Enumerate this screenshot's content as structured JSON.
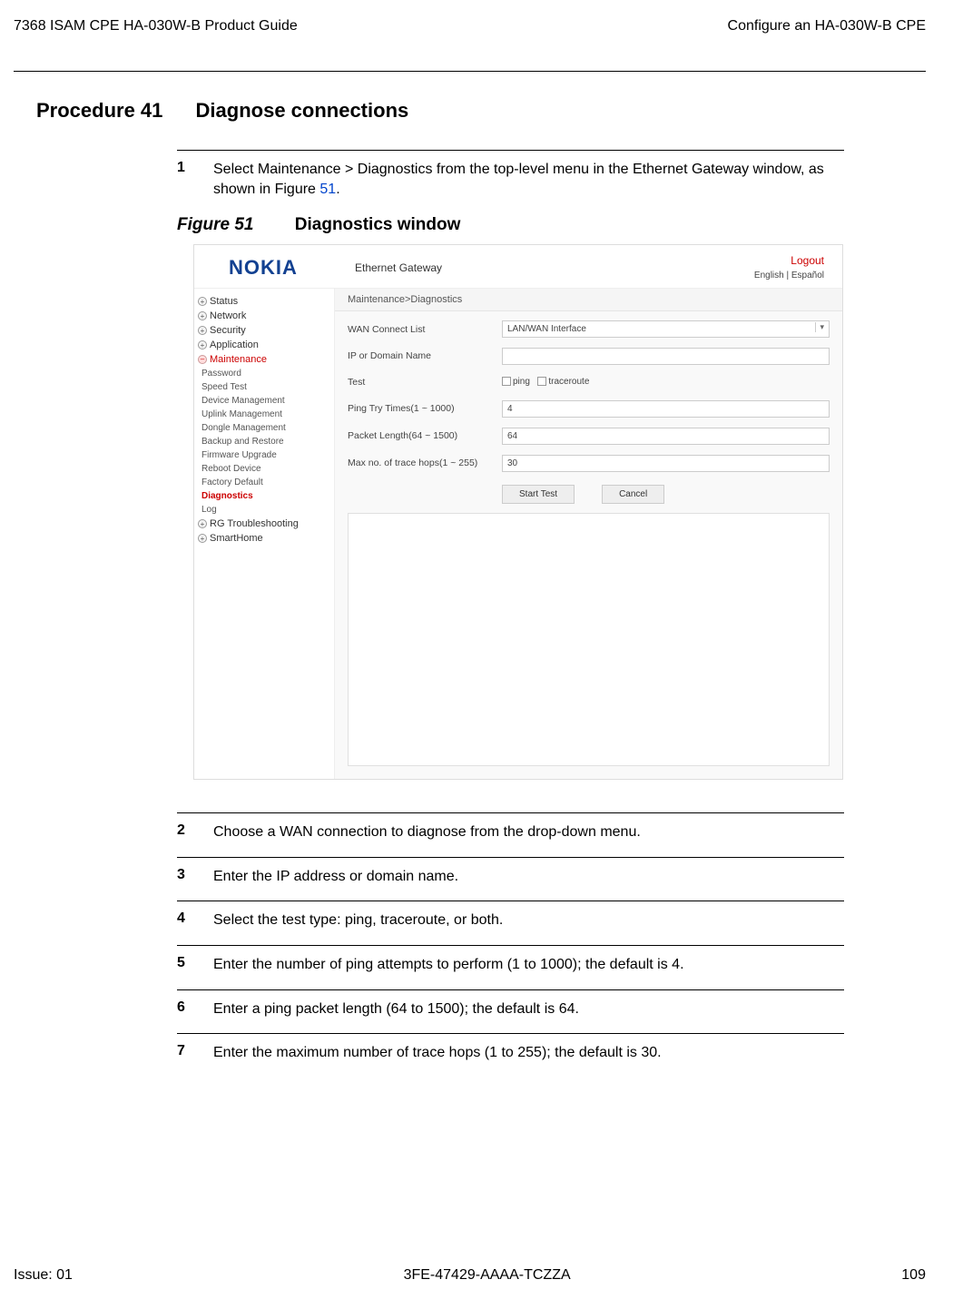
{
  "header": {
    "left": "7368 ISAM CPE HA-030W-B Product Guide",
    "right": "Configure an HA-030W-B CPE"
  },
  "procedure": {
    "number": "Procedure 41",
    "title": "Diagnose connections"
  },
  "steps": [
    {
      "n": "1",
      "text_prefix": "Select Maintenance > Diagnostics from the top-level menu in the Ethernet Gateway window, as shown in Figure ",
      "link": "51",
      "text_suffix": "."
    },
    {
      "n": "2",
      "text": "Choose a WAN connection to diagnose from the drop-down menu."
    },
    {
      "n": "3",
      "text": "Enter the IP address or domain name."
    },
    {
      "n": "4",
      "text": "Select the test type: ping, traceroute, or both."
    },
    {
      "n": "5",
      "text": "Enter the number of ping attempts to perform (1 to 1000); the default is 4."
    },
    {
      "n": "6",
      "text": "Enter a ping packet length (64 to 1500); the default is 64."
    },
    {
      "n": "7",
      "text": "Enter the maximum number of trace hops (1 to 255); the default is 30."
    }
  ],
  "figure": {
    "number": "Figure 51",
    "title": "Diagnostics window"
  },
  "screenshot": {
    "logo": "NOKIA",
    "title": "Ethernet Gateway",
    "logout": "Logout",
    "lang": "English | Español",
    "breadcrumb": "Maintenance>Diagnostics",
    "sidebar": {
      "status": "Status",
      "network": "Network",
      "security": "Security",
      "application": "Application",
      "maintenance": "Maintenance",
      "subs": [
        "Password",
        "Speed Test",
        "Device Management",
        "Uplink Management",
        "Dongle Management",
        "Backup and Restore",
        "Firmware Upgrade",
        "Reboot Device",
        "Factory Default",
        "Diagnostics",
        "Log"
      ],
      "rg": "RG Troubleshooting",
      "smart": "SmartHome"
    },
    "form": {
      "wan_label": "WAN Connect List",
      "wan_value": "LAN/WAN Interface",
      "ip_label": "IP or Domain Name",
      "ip_value": "",
      "test_label": "Test",
      "ping_cb": "ping",
      "trace_cb": "traceroute",
      "tries_label": "Ping Try Times(1 ~ 1000)",
      "tries_value": "4",
      "len_label": "Packet Length(64 ~ 1500)",
      "len_value": "64",
      "hops_label": "Max no. of trace hops(1 ~ 255)",
      "hops_value": "30",
      "start_btn": "Start Test",
      "cancel_btn": "Cancel"
    }
  },
  "footer": {
    "issue": "Issue: 01",
    "doc": "3FE-47429-AAAA-TCZZA",
    "page": "109"
  }
}
